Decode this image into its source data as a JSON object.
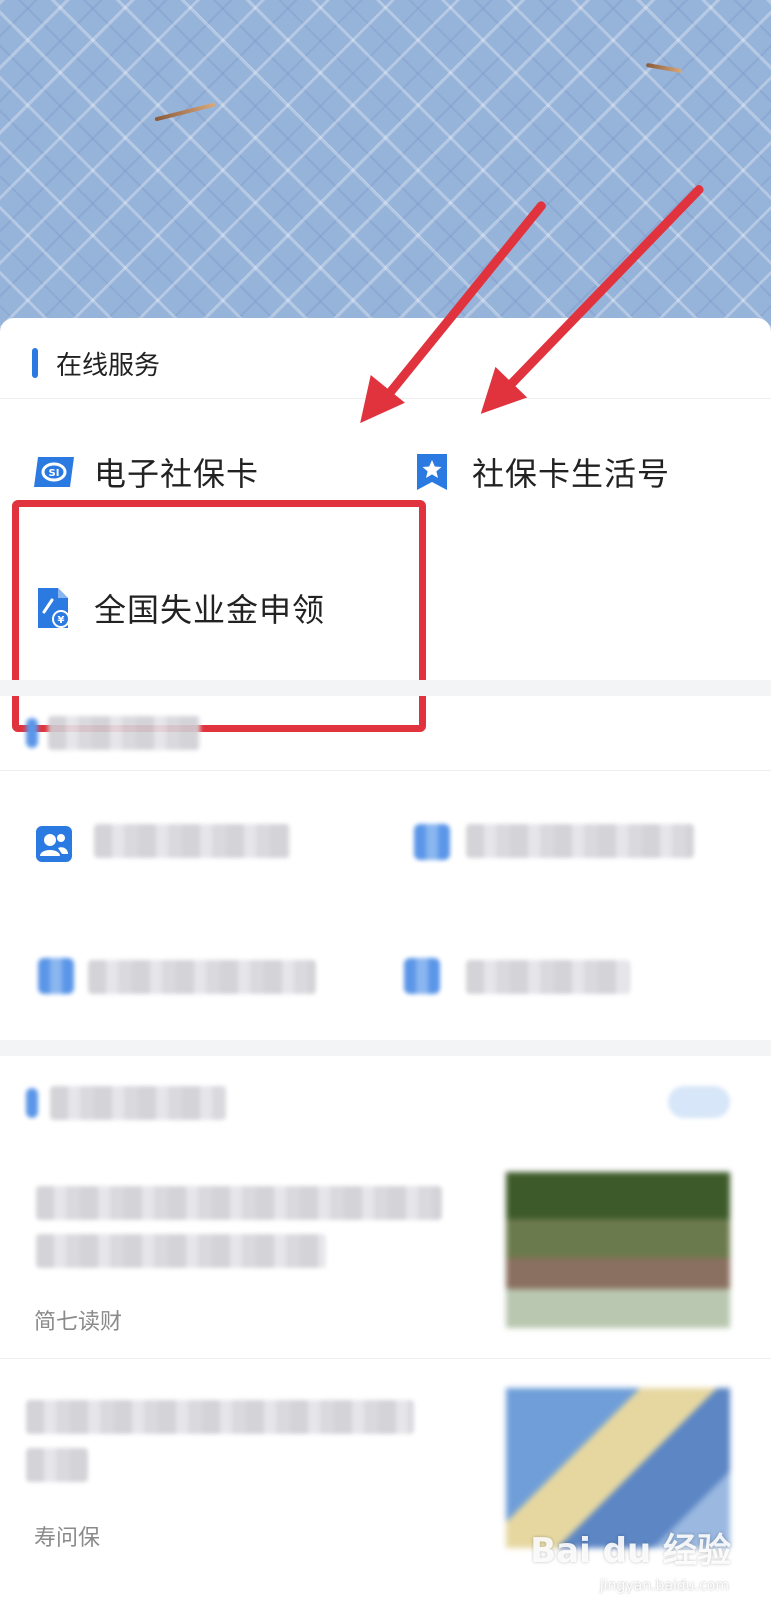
{
  "online_service": {
    "section_title": "在线服务",
    "items": [
      {
        "label": "电子社保卡",
        "icon": "social-security-card-icon"
      },
      {
        "label": "社保卡生活号",
        "icon": "bookmark-star-icon"
      },
      {
        "label": "全国失业金申领",
        "icon": "unemployment-benefit-document-icon"
      }
    ]
  },
  "articles": [
    {
      "source": "简七读财"
    },
    {
      "source": "寿问保"
    }
  ],
  "watermark": {
    "brand": "Bai du 经验",
    "url": "jingyan.baidu.com"
  },
  "colors": {
    "accent": "#2a7ae2",
    "highlight": "#e0333e",
    "banner": "#96b3da"
  }
}
